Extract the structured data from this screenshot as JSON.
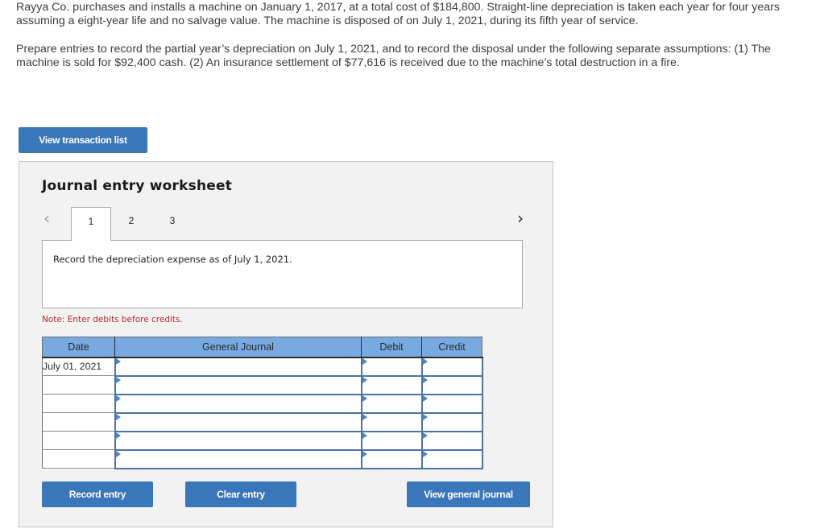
{
  "problem": {
    "paragraph_1": "Rayya Co. purchases and installs a machine on January 1, 2017, at a total cost of $184,800. Straight-line depreciation is taken each year for four years assuming a eight-year life and no salvage value. The machine is disposed of on July 1, 2021, during its fifth year of service.",
    "paragraph_2": "Prepare entries to record the partial year’s depreciation on July 1, 2021, and to record the disposal under the following separate assumptions: (1) The machine is sold for $92,400 cash. (2) An insurance settlement of $77,616 is received due to the machine’s total destruction in a fire."
  },
  "buttons": {
    "view_transaction_list": "View transaction list",
    "record_entry": "Record entry",
    "clear_entry": "Clear entry",
    "view_general_journal": "View general journal"
  },
  "worksheet": {
    "title": "Journal entry worksheet",
    "nav": {
      "prev_icon": "chevron-left-icon",
      "next_icon": "chevron-right-icon",
      "prev_glyph": "‹",
      "next_glyph": "›"
    },
    "tabs": [
      {
        "label": "1",
        "active": true
      },
      {
        "label": "2",
        "active": false
      },
      {
        "label": "3",
        "active": false
      }
    ],
    "instruction": "Record the depreciation expense as of July 1, 2021.",
    "note": "Note: Enter debits before credits."
  },
  "journal": {
    "headers": {
      "date": "Date",
      "general_journal": "General Journal",
      "debit": "Debit",
      "credit": "Credit"
    },
    "rows": [
      {
        "date": "July 01, 2021",
        "account": "",
        "debit": "",
        "credit": ""
      },
      {
        "date": "",
        "account": "",
        "debit": "",
        "credit": ""
      },
      {
        "date": "",
        "account": "",
        "debit": "",
        "credit": ""
      },
      {
        "date": "",
        "account": "",
        "debit": "",
        "credit": ""
      },
      {
        "date": "",
        "account": "",
        "debit": "",
        "credit": ""
      },
      {
        "date": "",
        "account": "",
        "debit": "",
        "credit": ""
      }
    ]
  },
  "colors": {
    "button_blue": "#3a76ba",
    "header_blue": "#78aae1",
    "input_border": "#4d73a3",
    "note_red": "#b4272c",
    "worksheet_bg": "#f2f2f2"
  }
}
